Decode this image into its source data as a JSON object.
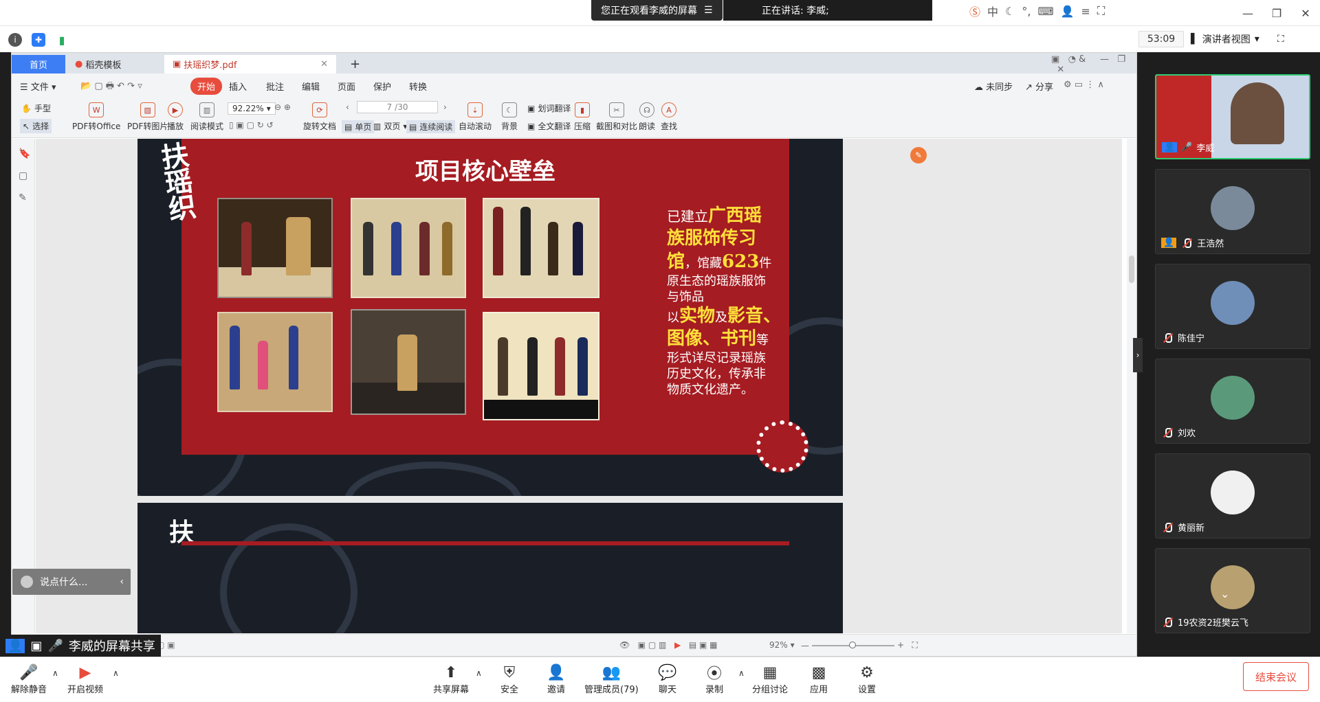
{
  "meeting": {
    "watching_text": "您正在观看李威的屏幕",
    "speaking_text": "正在讲话: 李威;",
    "timer": "53:09",
    "view_mode": "演讲者视图",
    "share_label": "李威的屏幕共享",
    "say_placeholder": "说点什么...",
    "end_label": "结束会议",
    "toolbar": {
      "unmute": "解除静音",
      "video": "开启视频",
      "share": "共享屏幕",
      "security": "安全",
      "invite": "邀请",
      "members": "管理成员(79)",
      "chat": "聊天",
      "record": "录制",
      "breakout": "分组讨论",
      "apps": "应用",
      "settings": "设置"
    }
  },
  "participants": [
    {
      "name": "李威",
      "active": true
    },
    {
      "name": "王浩然"
    },
    {
      "name": "陈佳宁"
    },
    {
      "name": "刘欢"
    },
    {
      "name": "黄丽新"
    },
    {
      "name": "19农资2班樊云飞"
    }
  ],
  "wps": {
    "tabs": [
      "首页",
      "稻壳模板",
      "扶瑶织梦.pdf"
    ],
    "menu": [
      "文件",
      "开始",
      "插入",
      "批注",
      "编辑",
      "页面",
      "保护",
      "转换"
    ],
    "menu_right": [
      "未同步",
      "分享"
    ],
    "tools": {
      "hand": "手型",
      "select": "选择",
      "pdf_office": "PDF转Office",
      "pdf_image": "PDF转图片",
      "play": "播放",
      "read_mode": "阅读模式",
      "zoom": "92.22%",
      "rotate": "旋转文档",
      "page": "7",
      "page_total": "/30",
      "single": "单页",
      "double": "双页",
      "continuous": "连续阅读",
      "autoscroll": "自动滚动",
      "background": "背景",
      "word_translate": "划词翻译",
      "full_translate": "全文翻译",
      "compress": "压缩",
      "screenshot": "截图和对比",
      "read_aloud": "朗读",
      "find": "查找"
    },
    "status_zoom": "92%"
  },
  "slide": {
    "title": "项目核心壁垒",
    "text": {
      "l1a": "已建立",
      "l1b": "广西瑶",
      "l2": "族服饰传习",
      "l3a": "馆",
      "l3b": "，馆藏",
      "l3c": "623",
      "l3d": "件",
      "l4": "原生态的瑶族服饰",
      "l5": "与饰品",
      "l6a": "以",
      "l6b": "实物",
      "l6c": "及",
      "l6d": "影音、",
      "l7a": "图像、书刊",
      "l7b": "等",
      "l8": "形式详尽记录瑶族",
      "l9": "历史文化，传承非",
      "l10": "物质文化遗产。"
    },
    "calligraphy": "扶瑶织梦"
  }
}
